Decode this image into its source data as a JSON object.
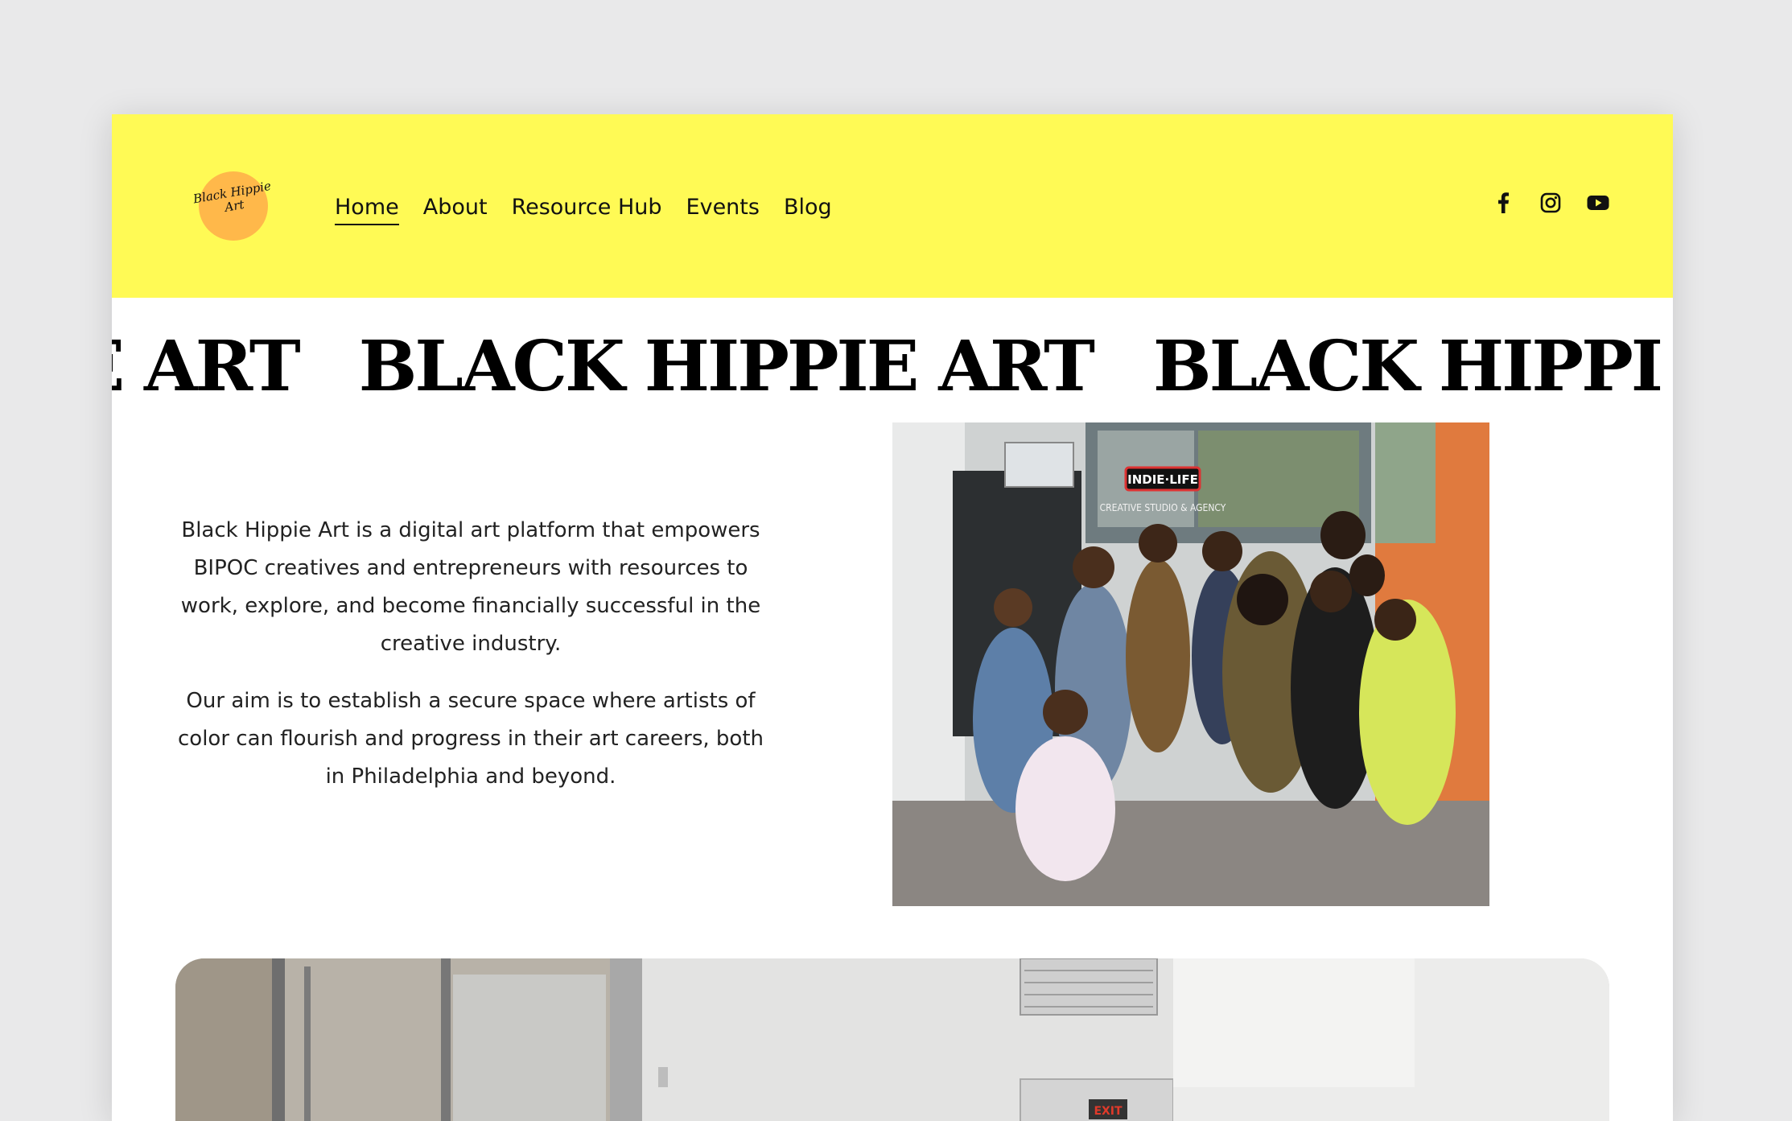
{
  "site": {
    "logo_text": "Black Hippie Art",
    "colors": {
      "header_bg": "#fffa55",
      "logo_circle": "#ffb84a",
      "text": "#111111"
    }
  },
  "nav": {
    "items": [
      {
        "label": "Home",
        "active": true
      },
      {
        "label": "About"
      },
      {
        "label": "Resource Hub"
      },
      {
        "label": "Events"
      },
      {
        "label": "Blog"
      }
    ]
  },
  "social": [
    "facebook-icon",
    "instagram-icon",
    "youtube-icon"
  ],
  "marquee": {
    "fragment_start": "PPIE ART",
    "full": "BLACK HIPPIE ART",
    "fragment_end": "BLACK HIPPI"
  },
  "intro": {
    "p1": "Black Hippie Art is a digital art platform that empowers BIPOC creatives and entrepreneurs with resources to work, explore, and become financially successful in the creative industry.",
    "p2": "Our aim is to establish a secure space where artists of color can flourish and progress in their art careers, both in Philadelphia and beyond."
  },
  "photo": {
    "storefront_sign": "INDIE·LIFE",
    "storefront_subtitle": "CREATIVE STUDIO & AGENCY"
  },
  "photo2": {
    "exit_sign": "EXIT"
  }
}
